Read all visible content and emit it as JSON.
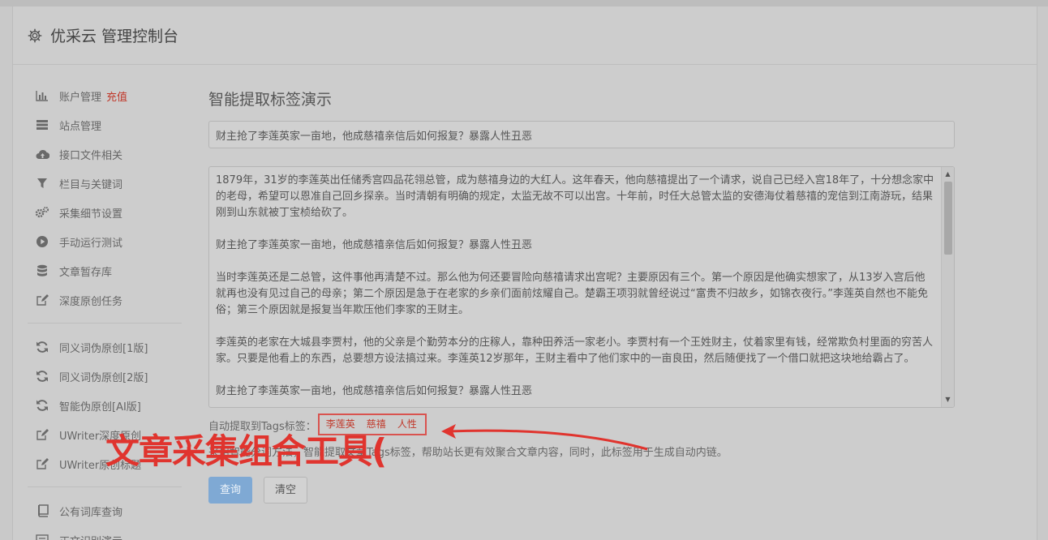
{
  "app": {
    "title": "优采云 管理控制台"
  },
  "sidebar": {
    "groups": [
      [
        {
          "icon": "bar-chart-icon",
          "label": "账户管理",
          "badge": "充值"
        },
        {
          "icon": "server-icon",
          "label": "站点管理"
        },
        {
          "icon": "cloud-upload-icon",
          "label": "接口文件相关"
        },
        {
          "icon": "filter-icon",
          "label": "栏目与关键词"
        },
        {
          "icon": "gears-icon",
          "label": "采集细节设置"
        },
        {
          "icon": "play-circle-icon",
          "label": "手动运行测试"
        },
        {
          "icon": "database-icon",
          "label": "文章暂存库"
        },
        {
          "icon": "edit-icon",
          "label": "深度原创任务"
        }
      ],
      [
        {
          "icon": "refresh-icon",
          "label": "同义词伪原创[1版]"
        },
        {
          "icon": "refresh-icon",
          "label": "同义词伪原创[2版]"
        },
        {
          "icon": "refresh-icon",
          "label": "智能伪原创[AI版]"
        },
        {
          "icon": "edit-icon",
          "label": "UWriter深度原创"
        },
        {
          "icon": "edit-icon",
          "label": "UWriter原创标题"
        }
      ],
      [
        {
          "icon": "book-icon",
          "label": "公有词库查询"
        },
        {
          "icon": "document-icon",
          "label": "正文识别演示"
        }
      ]
    ]
  },
  "main": {
    "page_title": "智能提取标签演示",
    "title_value": "财主抢了李莲英家一亩地，他成慈禧亲信后如何报复？暴露人性丑恶",
    "paragraphs": [
      "1879年，31岁的李莲英出任储秀宫四品花翎总管，成为慈禧身边的大红人。这年春天，他向慈禧提出了一个请求，说自己已经入宫18年了，十分想念家中的老母，希望可以恩准自己回乡探亲。当时清朝有明确的规定，太监无故不可以出宫。十年前，时任大总管太监的安德海仗着慈禧的宠信到江南游玩，结果刚到山东就被丁宝桢给砍了。",
      "财主抢了李莲英家一亩地，他成慈禧亲信后如何报复？暴露人性丑恶",
      "当时李莲英还是二总管，这件事他再清楚不过。那么他为何还要冒险向慈禧请求出宫呢？主要原因有三个。第一个原因是他确实想家了，从13岁入宫后他就再也没有见过自己的母亲；第二个原因是急于在老家的乡亲们面前炫耀自己。楚霸王项羽就曾经说过“富贵不归故乡，如锦衣夜行。”李莲英自然也不能免俗；第三个原因就是报复当年欺压他们李家的王财主。",
      "李莲英的老家在大城县李贾村，他的父亲是个勤劳本分的庄稼人，靠种田养活一家老小。李贾村有一个王姓财主，仗着家里有钱，经常欺负村里面的穷苦人家。只要是他看上的东西，总要想方设法搞过来。李莲英12岁那年，王财主看中了他们家中的一亩良田，然后随便找了一个借口就把这块地给霸占了。",
      "财主抢了李莲英家一亩地，他成慈禧亲信后如何报复？暴露人性丑恶"
    ],
    "tags_label": "自动提取到Tags标签：",
    "tags": [
      "李莲英",
      "慈禧",
      "人性"
    ],
    "description": "采用智能分词方法，智能提取文章Tags标签，帮助站长更有效聚合文章内容，同时，此标签用于生成自动内链。",
    "query_button": "查询",
    "clear_button": "清空"
  },
  "overlay": {
    "text": "文章采集组合工具("
  }
}
